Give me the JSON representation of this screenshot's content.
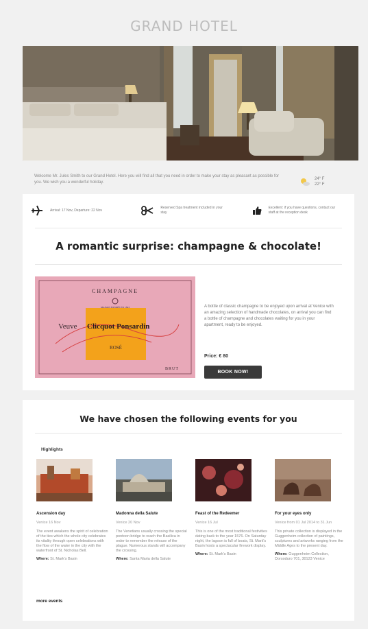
{
  "header": {
    "brand": "GRAND HOTEL"
  },
  "welcome": {
    "text": "Welcome Mr. Jules Smith to our Grand Hotel. Here you will find all that you need in order to make your stay as pleasant as possible for you. We wish you a wonderful holiday.",
    "temp_high": "24° F",
    "temp_low": "22° F"
  },
  "info_bar": [
    {
      "icon": "airplane-icon",
      "text": "Arrival: 17 Nov, Departure: 22 Nov"
    },
    {
      "icon": "scissors-icon",
      "text": "Reserved Spa treatment included in your stay"
    },
    {
      "icon": "thumbs-up-icon",
      "text": "Excellent: if you have questions, contact our staff at the reception desk"
    }
  ],
  "offer": {
    "title": "A romantic surprise: champagne & chocolate!",
    "label": {
      "top": "CHAMPAGNE",
      "small": "MAISON FONDÉE EN 1843",
      "brand_left": "Veuve",
      "brand_right": "Clicquot Ponsardin",
      "variety": "ROSÉ",
      "footer": "BRUT"
    },
    "description": "A bottle of classic champagne to be enjoyed upon arrival at Venice with an amazing selection of handmade chocolates, on arrival you can find a bottle of champagne and chocolates waiting for you in your apartment, ready to be enjoyed.",
    "price": "Price: € 80",
    "button": "BOOK NOW!"
  },
  "events_section": {
    "title": "We have chosen the following events for you",
    "highlights": "Highlights",
    "events": [
      {
        "title": "Ascension day",
        "date": "Venice 16 Nov",
        "body": "The event awakens the spirit of celebration of the ties which the whole city celebrates its vitality through open celebrations with the flow of the water in the city with the waterfront of St. Nicholas Bell.",
        "where_label": "Where:",
        "where_value": "St. Mark's Basin"
      },
      {
        "title": "Madonna della Salute",
        "date": "Venice 20 Nov",
        "body": "The Venetians usually crossing the special pontoon bridge to reach the Basilica in order to remember the release of the plague. Numerous stands will accompany the crossing.",
        "where_label": "Where:",
        "where_value": "Santa Maria della Salute"
      },
      {
        "title": "Feast of the Redeemer",
        "date": "Venice 16 Jul",
        "body": "This is one of the most traditional festivities dating back to the year 1576. On Saturday night, the lagoon is full of boats, St. Mark's Basin hosts a spectacular firework display.",
        "where_label": "Where:",
        "where_value": "St. Mark's Basin"
      },
      {
        "title": "For your eyes only",
        "date": "Venice from 01 Jul 2014 to 31 Jun",
        "body": "This private collection is displayed in the Guggenheim collection of paintings, sculptures and artworks ranging from the Middle Ages to the present day.",
        "where_label": "Where:",
        "where_value": "Guggenheim Collection, Dorsoduro 701, 30123 Venice"
      }
    ],
    "more": "more events"
  }
}
